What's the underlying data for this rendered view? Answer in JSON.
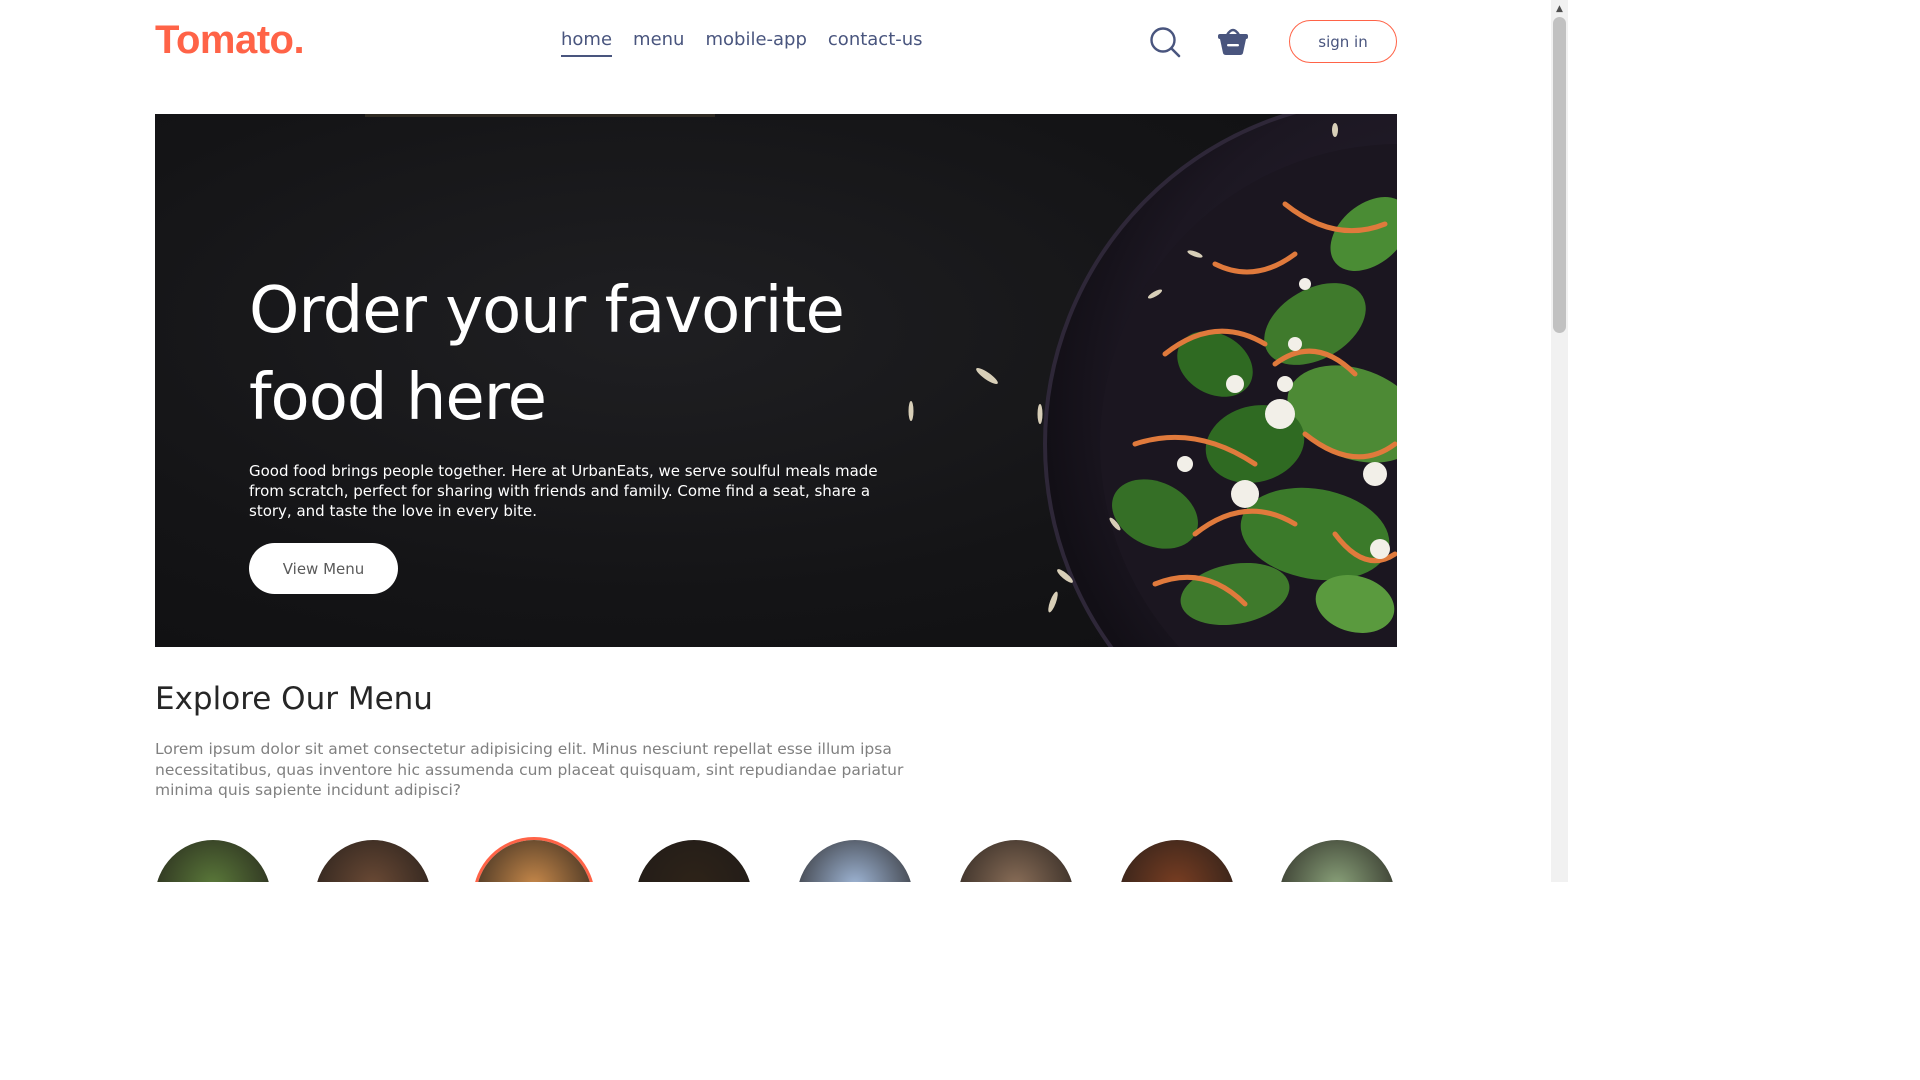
{
  "logo": "Tomato.",
  "nav": {
    "links": [
      "home",
      "menu",
      "mobile-app",
      "contact-us"
    ],
    "active": "home",
    "sign_in": "sign in"
  },
  "icons": {
    "search": "search-icon",
    "basket": "basket-icon"
  },
  "hero": {
    "title": "Order your favorite food here",
    "description": "Good food brings people together. Here at UrbanEats, we serve soulful meals made from scratch, perfect for sharing with friends and family. Come find a seat, share a story, and taste the love in every bite.",
    "button": "View Menu"
  },
  "explore": {
    "title": "Explore Our Menu",
    "text": "Lorem ipsum dolor sit amet consectetur adipisicing elit. Minus nesciunt repellat esse illum ipsa necessitatibus, quas inventore hic assumenda cum placeat quisquam, sint repudiandae pariatur minima quis sapiente incidunt adipisci?"
  },
  "colors": {
    "accent": "#ff6347",
    "nav_text": "#49557e",
    "hero_bg": "#141416"
  },
  "menu_items": [
    {
      "color": "#5b7a3a",
      "active": false
    },
    {
      "color": "#6b4a35",
      "active": false
    },
    {
      "color": "#c8894a",
      "active": true
    },
    {
      "color": "#2e2318",
      "active": false
    },
    {
      "color": "#9fb6d6",
      "active": false
    },
    {
      "color": "#8a6e58",
      "active": false
    },
    {
      "color": "#7a3e22",
      "active": false
    },
    {
      "color": "#8aa27a",
      "active": false
    }
  ]
}
